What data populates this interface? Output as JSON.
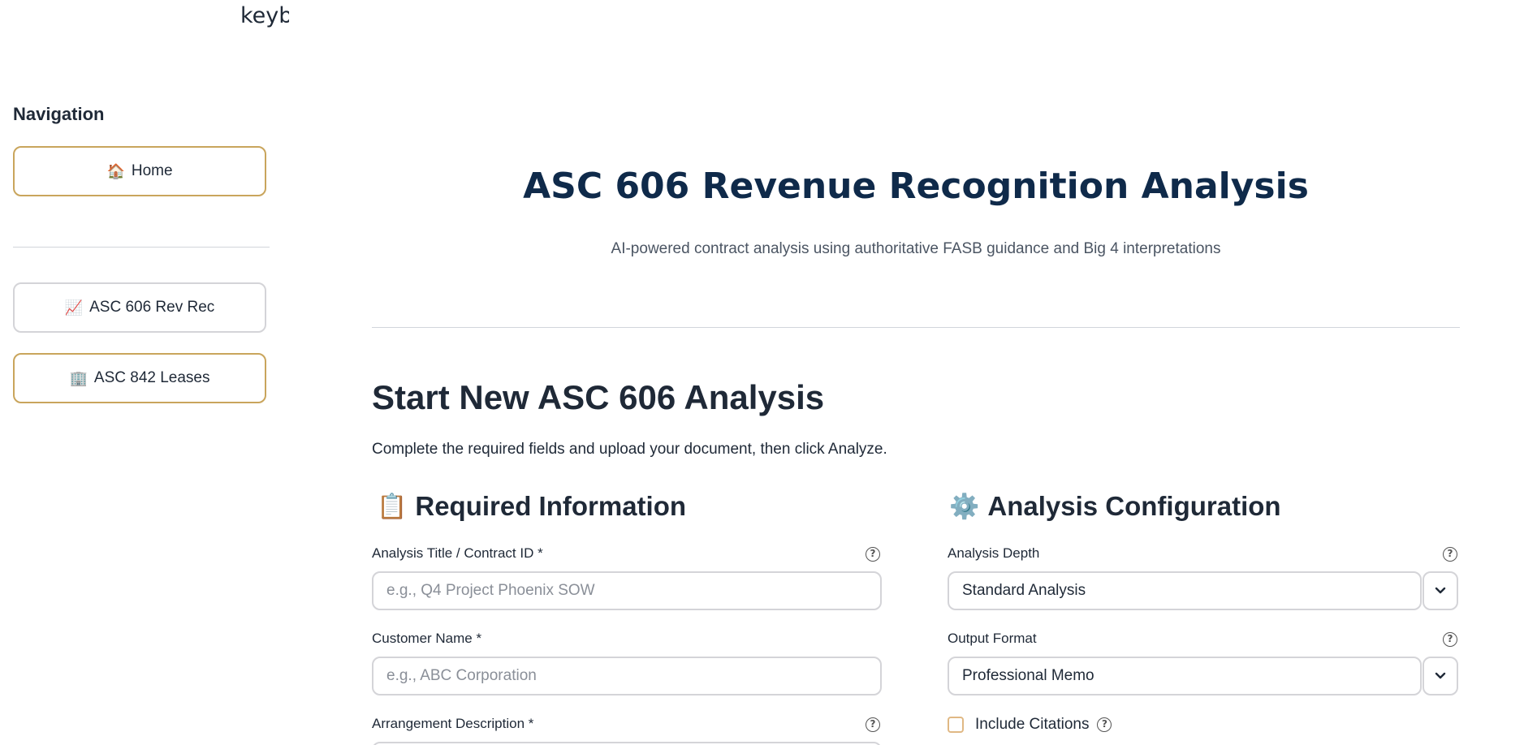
{
  "top_clip_text": "keyb",
  "sidebar": {
    "title": "Navigation",
    "items": [
      {
        "emoji": "🏠",
        "label": "Home"
      },
      {
        "emoji": "📈",
        "label": "ASC 606 Rev Rec"
      },
      {
        "emoji": "🏢",
        "label": "ASC 842 Leases"
      }
    ]
  },
  "hero": {
    "title": "ASC 606 Revenue Recognition Analysis",
    "subtitle": "AI-powered contract analysis using authoritative FASB guidance and Big 4 interpretations"
  },
  "section": {
    "title": "Start New ASC 606 Analysis",
    "description": "Complete the required fields and upload your document, then click Analyze."
  },
  "required": {
    "emoji": "📋",
    "title": "Required Information",
    "fields": {
      "analysis_title": {
        "label": "Analysis Title / Contract ID *",
        "placeholder": "e.g., Q4 Project Phoenix SOW",
        "value": ""
      },
      "customer_name": {
        "label": "Customer Name *",
        "placeholder": "e.g., ABC Corporation",
        "value": ""
      },
      "arrangement_description": {
        "label": "Arrangement Description *"
      }
    }
  },
  "config": {
    "emoji": "⚙️",
    "title": "Analysis Configuration",
    "analysis_depth": {
      "label": "Analysis Depth",
      "value": "Standard Analysis"
    },
    "output_format": {
      "label": "Output Format",
      "value": "Professional Memo"
    },
    "include_citations": {
      "label": "Include Citations",
      "checked": false
    }
  },
  "icons": {
    "help": "?"
  }
}
